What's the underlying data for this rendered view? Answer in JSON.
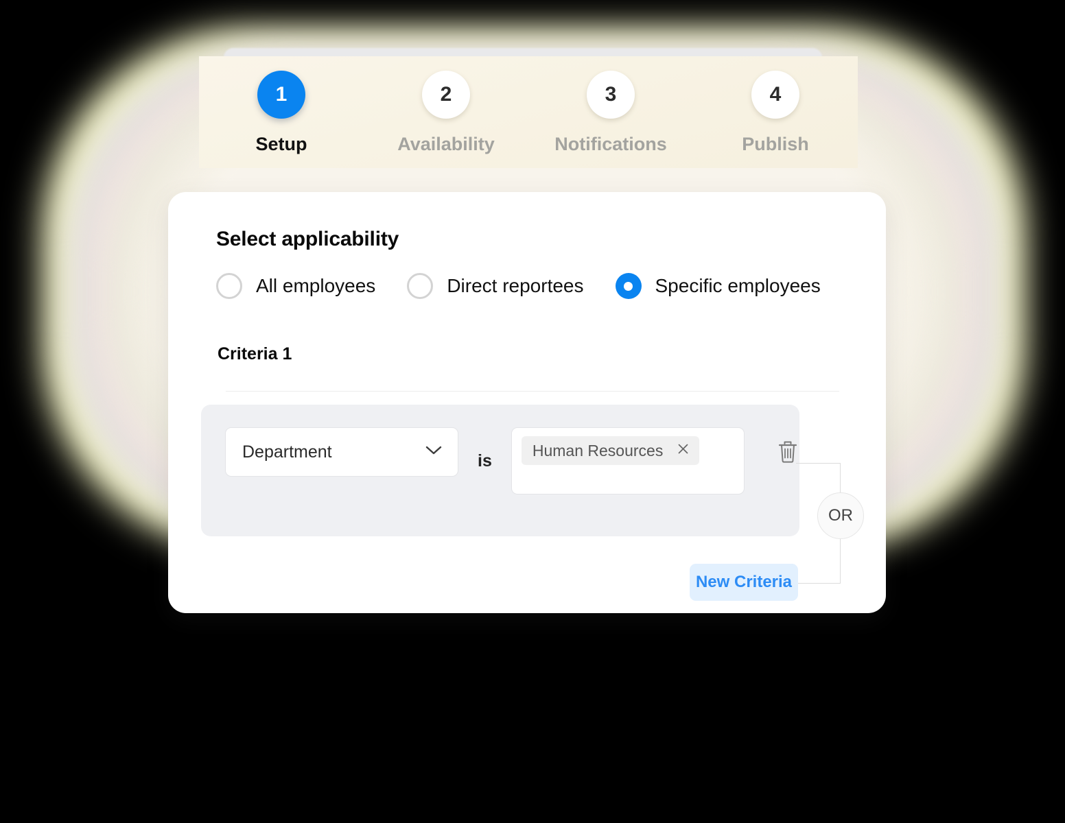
{
  "stepper": {
    "steps": [
      {
        "number": "1",
        "label": "Setup",
        "state": "active"
      },
      {
        "number": "2",
        "label": "Availability",
        "state": "inactive"
      },
      {
        "number": "3",
        "label": "Notifications",
        "state": "inactive"
      },
      {
        "number": "4",
        "label": "Publish",
        "state": "inactive"
      }
    ]
  },
  "card": {
    "title": "Select applicability",
    "applicability": {
      "options": [
        {
          "label": "All employees",
          "selected": false
        },
        {
          "label": "Direct reportees",
          "selected": false
        },
        {
          "label": "Specific employees",
          "selected": true
        }
      ]
    },
    "criteria_heading": "Criteria 1",
    "criteria": {
      "field": "Department",
      "operator": "is",
      "values": [
        "Human Resources"
      ],
      "delete_icon": "trash-icon",
      "chip_remove_icon": "close-icon",
      "dropdown_icon": "chevron-down-icon"
    },
    "connector": {
      "label": "OR"
    },
    "new_criteria_label": "New Criteria"
  },
  "colors": {
    "accent_blue": "#0A84F0",
    "link_blue": "#2D8CF5",
    "link_blue_bg": "#E2F0FE",
    "panel_grey": "#EFF0F3",
    "chip_grey": "#F0F0F0",
    "stepper_beige": "#F8F3E4",
    "glow_yellow": "#FBFBC8"
  }
}
